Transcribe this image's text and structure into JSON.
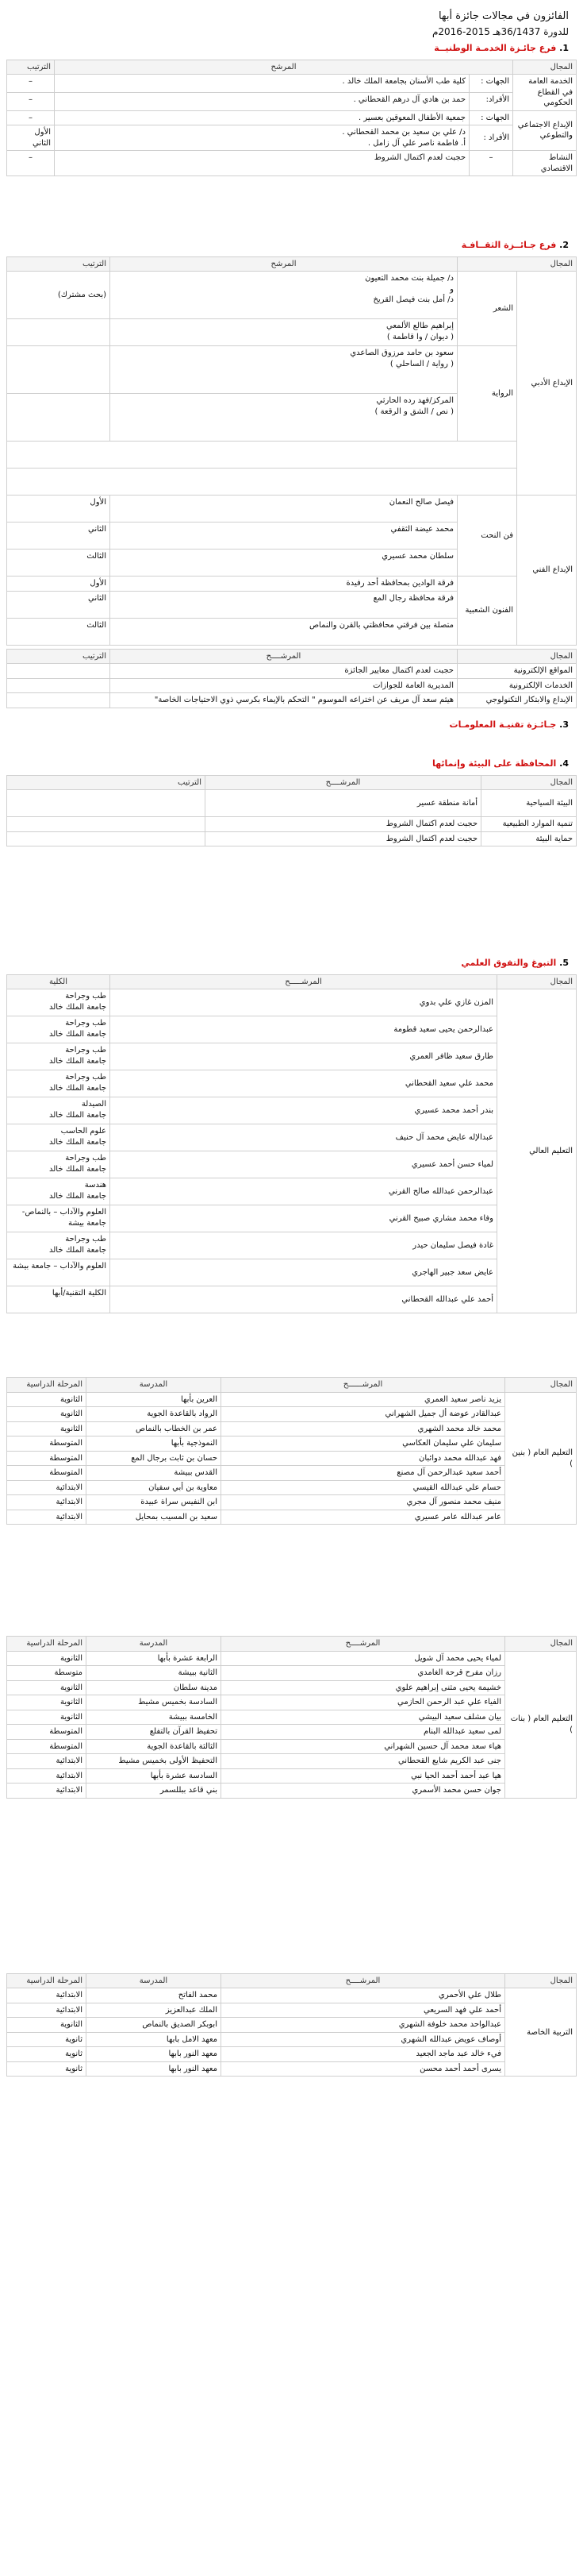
{
  "header": {
    "title": "الفائزون في مجالات جائزة أبها",
    "session": "للدورة 36/1437هـ 2015-2016م"
  },
  "s1": {
    "num": "1.",
    "title": "فرع جائـزة الخدمـة الوطنيــة",
    "col_field": "المجال",
    "col_candidate": "المرشح",
    "col_rank": "الترتيب",
    "public_service": "الخدمة العامة في القطاع الحكومي",
    "gov_label": "الجهات :",
    "gov_candidate": "كلية طب الأسنان بجامعة الملك خالد .",
    "social_field": "الإبداع الاجتماعي والتطوعي",
    "ind_label": "الأفراد:",
    "ind_candidate": "حمد بن هادي آل درهم القحطاني .",
    "ent_label": "الجهات :",
    "ent_candidate": "جمعية الأطفال المعوقين بعسير .",
    "ind2_label": "الأفراد :",
    "ind2_c1": "د/ علي بن سعيد بن محمد القحطاني .",
    "ind2_c2": "أ. فاطمة ناصر علي آل زامل .",
    "first": "الأول",
    "second": "الثاني",
    "econ_field": "النشاط الاقتصادي",
    "econ_text": "حجبت لعدم اكتمال الشروط",
    "dash": "–"
  },
  "s2": {
    "num": "2.",
    "title": "فرع جـائــزة الثقــافـة",
    "col_field": "المجال",
    "col_candidate": "المرشح",
    "col_rank": "الترتيب",
    "lit_field": "الإبداع الأدبي",
    "poetry": "الشعر",
    "novel": "الرواية",
    "c1": "د/ جميلة بنت محمد التعيون",
    "and": "و",
    "c2": "د/ أمل بنت فيصل القريخ",
    "shared": "(بحث مشترك)",
    "poet": "إبراهيم طالع الألمعي",
    "poet_work": "( ديوان / وا قاطمة )",
    "novelist": "سعود بن حامد مرزوق الصاعدي",
    "novel_work": "( رواية / الساحلي )",
    "harthi": "المركز/فهد رده الحارثي",
    "harthi_work": "( نص / الشق و الرقعة )",
    "art_field": "الإبداع الفني",
    "sculpt": "فن النحت",
    "sculptors": [
      "فيصل صالح النعمان",
      "محمد عيضة الثقفي",
      "سلطان محمد عسيري"
    ],
    "ranks": [
      "الأول",
      "الثاني",
      "الثالث"
    ],
    "folk": "الفنون الشعبية",
    "troupes": [
      "فرقة الوادين بمحافظة أحد رفيدة",
      "فرقة محافظة رجال المع",
      "متصلة بين فرقتي محافظتي بالقرن والنماص"
    ],
    "col_field2": "المجال",
    "col_candidate2": "المرشــــح",
    "col_rank2": "الترتيب",
    "web_field": "المواقع الإلكترونية",
    "web_text": "حجبت لعدم اكتمال معايير الجائزة",
    "eserv_field": "الخدمات الإلكترونية",
    "eserv_text": "المديرية العامة للجوازات",
    "tech_field": "الإبداع والابتكار التكنولوجي",
    "tech_text": "هيثم سعد آل مريف عن اختراعه الموسوم \" التحكم بالإيماء بكرسي ذوي الاحتياجات الخاصة\""
  },
  "s3": {
    "num": "3.",
    "title": "جـائـزة تقنيـة المعلومـات"
  },
  "s4": {
    "num": "4.",
    "title": "المحافظة على البيئة وإنمائها",
    "col_field": "المجال",
    "col_candidate": "المرشــــح",
    "col_rank": "الترتيب",
    "tourism": "البيئة السياحية",
    "tourism_c": "أمانة منطقة عسير",
    "natural": "تنمية الموارد الطبيعية",
    "natural_c": "حجبت لعدم اكتمال الشروط",
    "protect": "حماية البيئة",
    "protect_c": "حجبت لعدم اكتمال الشروط"
  },
  "s5": {
    "num": "5.",
    "title": "التبوغ والتفوق العلمي",
    "col_field": "المجال",
    "col_candidate": "المرشـــــح",
    "col_college": "الكلية",
    "higher_ed": "التعليم العالي",
    "higher_rows": [
      {
        "name": "المزن غازي علي بدوي",
        "college": "طب وجراحة",
        "uni": "جامعة الملك خالد"
      },
      {
        "name": "عبدالرحمن يحيى سعيد قطومة",
        "college": "طب وجراحة",
        "uni": "جامعة الملك خالد"
      },
      {
        "name": "طارق سعيد ظافر العمري",
        "college": "طب وجراحة",
        "uni": "جامعة الملك خالد"
      },
      {
        "name": "محمد علي سعيد القحطاني",
        "college": "طب وجراحة",
        "uni": "جامعة الملك خالد"
      },
      {
        "name": "بندر أحمد محمد عسيري",
        "college": "الصيدلة",
        "uni": "جامعة الملك خالد"
      },
      {
        "name": "عبدالإله عايض محمد آل حنيف",
        "college": "علوم الحاسب",
        "uni": "جامعة الملك خالد"
      },
      {
        "name": "لمياء حسن أحمد عسيري",
        "college": "طب وجراحة",
        "uni": "جامعة الملك خالد"
      },
      {
        "name": "عبدالرحمن عبدالله صالح القرني",
        "college": "هندسة",
        "uni": "جامعة الملك خالد"
      },
      {
        "name": "وفاء محمد مشاري صبيح القرني",
        "college": "العلوم والآداب – بالنماص-جامعة بيشة",
        "uni": ""
      },
      {
        "name": "غادة فيصل سليمان حيدر",
        "college": "طب وجراحة",
        "uni": "جامعة الملك خالد"
      },
      {
        "name": "عايض سعد جبير الهاجري",
        "college": "العلوم والآداب – جامعة بيشة",
        "uni": ""
      },
      {
        "name": "أحمد علي عبدالله القحطاني",
        "college": "الكلية التقنية/أبها",
        "uni": ""
      }
    ],
    "col_stage": "المرحلة الدراسية",
    "col_school": "المدرسة",
    "col_candidate2": "المرشــــــح",
    "col_field2": "المجال",
    "boys_field": "التعليم العام ( بنين )",
    "boys_rows": [
      {
        "name": "يزيد ناصر سعيد العمري",
        "school": "العرين بأبها",
        "stage": "الثانوية"
      },
      {
        "name": "عبدالقادر عوضة أل جميل الشهراني",
        "school": "الرواد بالقاعدة الجوية",
        "stage": "الثانوية"
      },
      {
        "name": "محمد خالد محمد الشهري",
        "school": "عمر بن الخطاب بالنماص",
        "stage": "الثانوية"
      },
      {
        "name": "سليمان علي سليمان العكاسي",
        "school": "النموذجية بأبها",
        "stage": "المتوسطة"
      },
      {
        "name": "فهد عبدالله محمد دوائبان",
        "school": "حسان بن ثابت برجال المع",
        "stage": "المتوسطة"
      },
      {
        "name": "أحمد سعيد عبدالرحمن آل مصنع",
        "school": "القدس ببيشة",
        "stage": "المتوسطة"
      },
      {
        "name": "حسام علي عبدالله القيسي",
        "school": "معاوية بن أبي سفيان",
        "stage": "الابتدائية"
      },
      {
        "name": "منيف محمد منصور آل مجري",
        "school": "ابن النفيس سراة عبيدة",
        "stage": "الابتدائية"
      },
      {
        "name": "عامر عبدالله عامر عسيري",
        "school": "سعيد بن المسيب بمحايل",
        "stage": "الابتدائية"
      }
    ],
    "col_field3": "المجال",
    "col_candidate3": "المرشــــح",
    "col_school3": "المدرسة",
    "col_stage3": "المرحلة الدراسية",
    "girls_field": "التعليم العام ( بنات )",
    "girls_rows": [
      {
        "name": "لمياء يحيى محمد آل شويل",
        "school": "الرابعة عشرة بأبها",
        "stage": "الثانوية"
      },
      {
        "name": "رزان مفرح قرحة الغامدي",
        "school": "الثانية ببيشة",
        "stage": "متوسطة"
      },
      {
        "name": "خشيمة يحيى مثنى إبراهيم علوي",
        "school": "مدينة سلطان",
        "stage": "الثانوية"
      },
      {
        "name": "الفياء علي عبد الرحمن الحازمي",
        "school": "السادسة بخميس مشيط",
        "stage": "الثانوية"
      },
      {
        "name": "بيان مشلف سعيد البيشي",
        "school": "الخامسة ببيشة",
        "stage": "الثانوية"
      },
      {
        "name": "لمى سعيد عبدالله البنام",
        "school": "تحفيظ القرآن بالتفلع",
        "stage": "المتوسطة"
      },
      {
        "name": "هياء سعد محمد آل حسين الشهراني",
        "school": "الثالثة بالقاعدة الجوية",
        "stage": "المتوسطة"
      },
      {
        "name": "جنى عبد الكريم شايع القحطاني",
        "school": "التحفيظ الأولى بخميس مشيط",
        "stage": "الابتدائية"
      },
      {
        "name": "هيا عبد أحمد أحمد الحيا نبي",
        "school": "السادسة عشرة بأبها",
        "stage": "الابتدائية"
      },
      {
        "name": "جوان حسن محمد الأسمري",
        "school": "بني قاعد ببللسمر",
        "stage": "الابتدائية"
      }
    ],
    "col_field4": "المجال",
    "col_candidate4": "المرشــــح",
    "col_school4": "المدرسة",
    "col_stage4": "المرحلة الدراسية",
    "special_field": "التربية الخاصة",
    "special_rows": [
      {
        "name": "طلال علي الأحمري",
        "school": "محمد الفاتح",
        "stage": "الابتدائية"
      },
      {
        "name": "أحمد علي فهد السريعي",
        "school": "الملك عبدالعزيز",
        "stage": "الابتدائية"
      },
      {
        "name": "عبدالواحد محمد خلوفة الشهري",
        "school": "ابوبكر الصديق بالنماص",
        "stage": "الثانوية"
      },
      {
        "name": "أوصاف عويض عبدالله الشهري",
        "school": "معهد الامل بابها",
        "stage": "ثانوية"
      },
      {
        "name": "فيء خالد عبد ماجد الجعيد",
        "school": "معهد النور بابها",
        "stage": "ثانوية"
      },
      {
        "name": "يسرى أحمد أحمد محسن",
        "school": "معهد النور بابها",
        "stage": "ثانوية"
      }
    ]
  }
}
